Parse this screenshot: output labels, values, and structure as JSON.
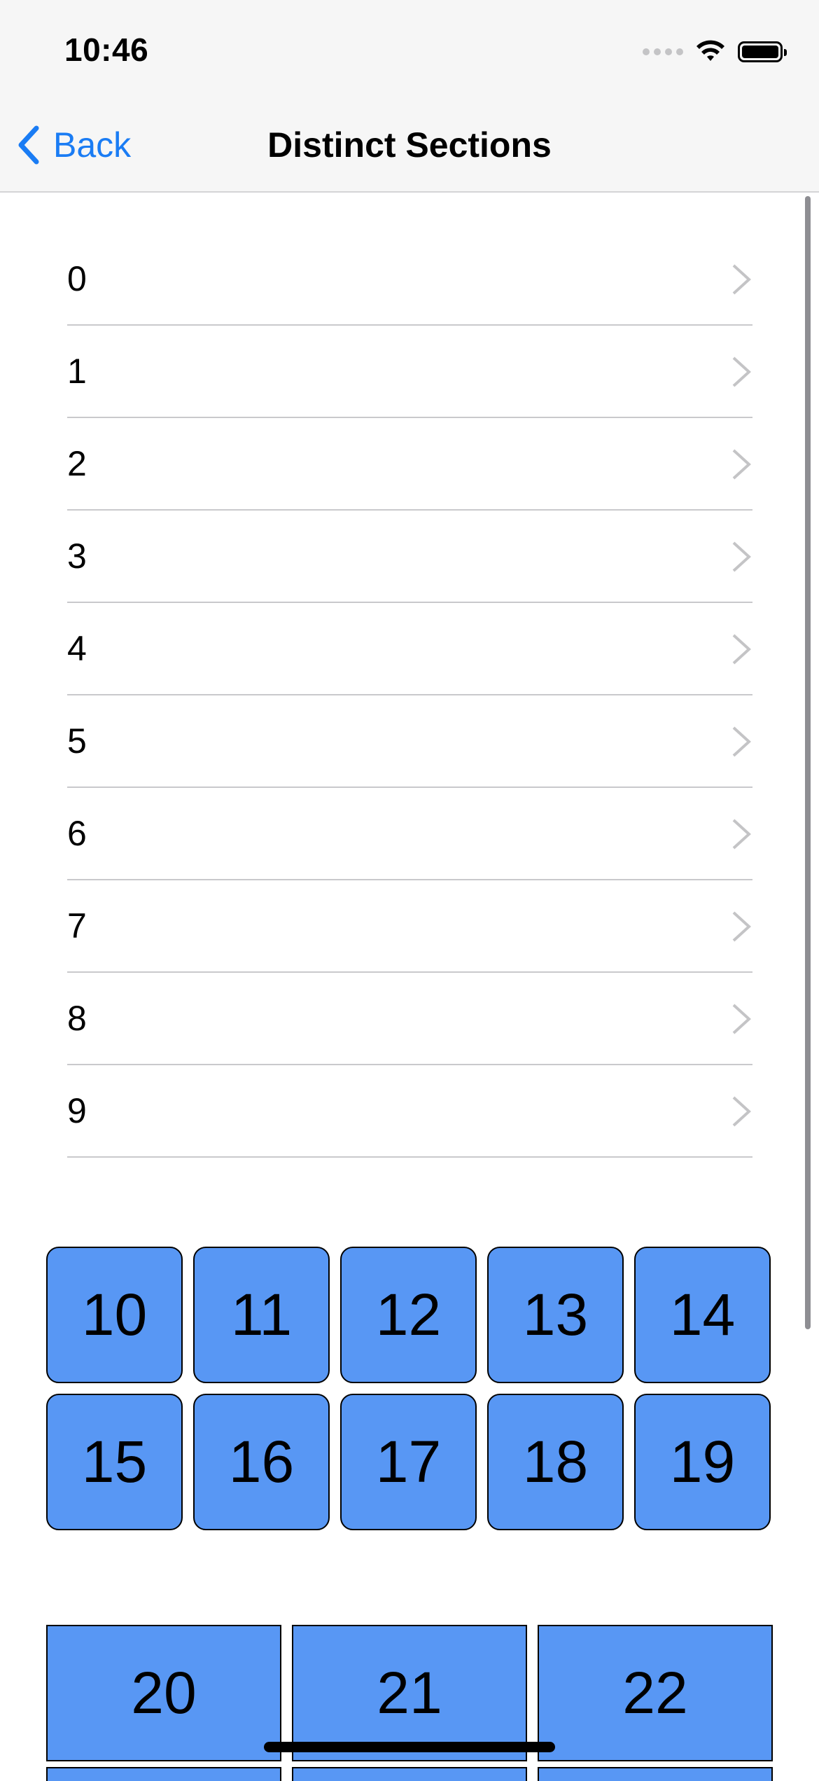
{
  "status_bar": {
    "time": "10:46"
  },
  "nav": {
    "back_label": "Back",
    "title": "Distinct Sections"
  },
  "list": {
    "items": [
      "0",
      "1",
      "2",
      "3",
      "4",
      "5",
      "6",
      "7",
      "8",
      "9"
    ]
  },
  "grid": {
    "items": [
      "10",
      "11",
      "12",
      "13",
      "14",
      "15",
      "16",
      "17",
      "18",
      "19"
    ]
  },
  "wide_row": {
    "items": [
      "20",
      "21",
      "22"
    ]
  },
  "colors": {
    "accent": "#1a7cf4",
    "cell_fill": "#5897f4",
    "separator": "#c9c9cc",
    "chevron": "#c4c4c6"
  },
  "icons": {
    "back": "chevron-left-icon",
    "disclosure": "chevron-right-icon"
  }
}
